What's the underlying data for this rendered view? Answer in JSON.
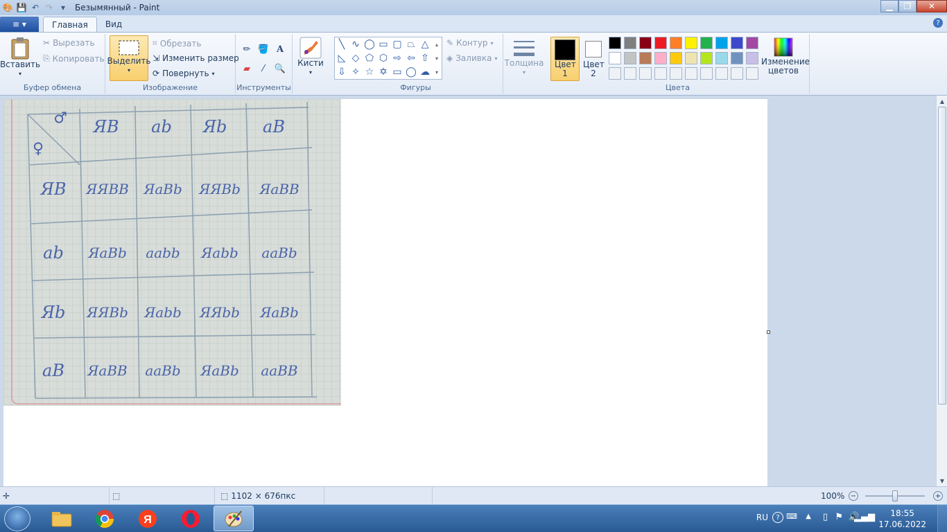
{
  "window": {
    "title": "Безымянный - Paint",
    "minimize": "▁",
    "maximize": "❐",
    "close": "✕"
  },
  "ribbon_tabs": {
    "file_menu": "≡ ▾",
    "tabs": [
      "Главная",
      "Вид"
    ]
  },
  "clipboard": {
    "paste": "Вставить",
    "cut": "Вырезать",
    "copy": "Копировать",
    "label": "Буфер обмена"
  },
  "image": {
    "select": "Выделить",
    "crop": "Обрезать",
    "resize": "Изменить размер",
    "rotate": "Повернуть",
    "label": "Изображение"
  },
  "tools": {
    "label": "Инструменты",
    "items": [
      "pencil-icon",
      "fill-icon",
      "text-icon",
      "eraser-icon",
      "color-picker-icon",
      "magnifier-icon"
    ]
  },
  "brushes": {
    "label": "Кисти"
  },
  "shapes": {
    "label": "Фигуры",
    "outline": "Контур",
    "fill": "Заливка"
  },
  "size": {
    "label": "Толщина"
  },
  "colors": {
    "color1": "Цвет 1",
    "color2": "Цвет 2",
    "edit": "Изменение цветов",
    "label": "Цвета",
    "color1_value": "#000000",
    "color2_value": "#ffffff",
    "palette_row1": [
      "#000000",
      "#7f7f7f",
      "#880015",
      "#ed1c24",
      "#ff7f27",
      "#fff200",
      "#22b14c",
      "#00a2e8",
      "#3f48cc",
      "#a349a4"
    ],
    "palette_row2": [
      "#ffffff",
      "#c3c3c3",
      "#b97a57",
      "#ffaec9",
      "#ffc90e",
      "#efe4b0",
      "#b5e61d",
      "#99d9ea",
      "#7092be",
      "#c8bfe7"
    ],
    "palette_row3_empty": 10
  },
  "photo": {
    "header": [
      "♂",
      "ЯВ",
      "ab",
      "Яb",
      "aB"
    ],
    "corner_female": "♀",
    "rows": [
      [
        "ЯВ",
        "ЯЯВВ",
        "ЯаВb",
        "ЯЯВb",
        "ЯаВВ"
      ],
      [
        "ab",
        "ЯаВb",
        "aabb",
        "Яаbb",
        "aaВb"
      ],
      [
        "Яb",
        "ЯЯВb",
        "Яаbb",
        "ЯЯbb",
        "ЯаВb"
      ],
      [
        "aB",
        "ЯаВВ",
        "aaВb",
        "ЯаВb",
        "aaВВ"
      ]
    ]
  },
  "status": {
    "size": "1102 × 676пкс",
    "zoom": "100%",
    "zoom_fraction": 0.5
  },
  "taskbar": {
    "lang": "RU",
    "time": "18:55",
    "date": "17.06.2022"
  }
}
